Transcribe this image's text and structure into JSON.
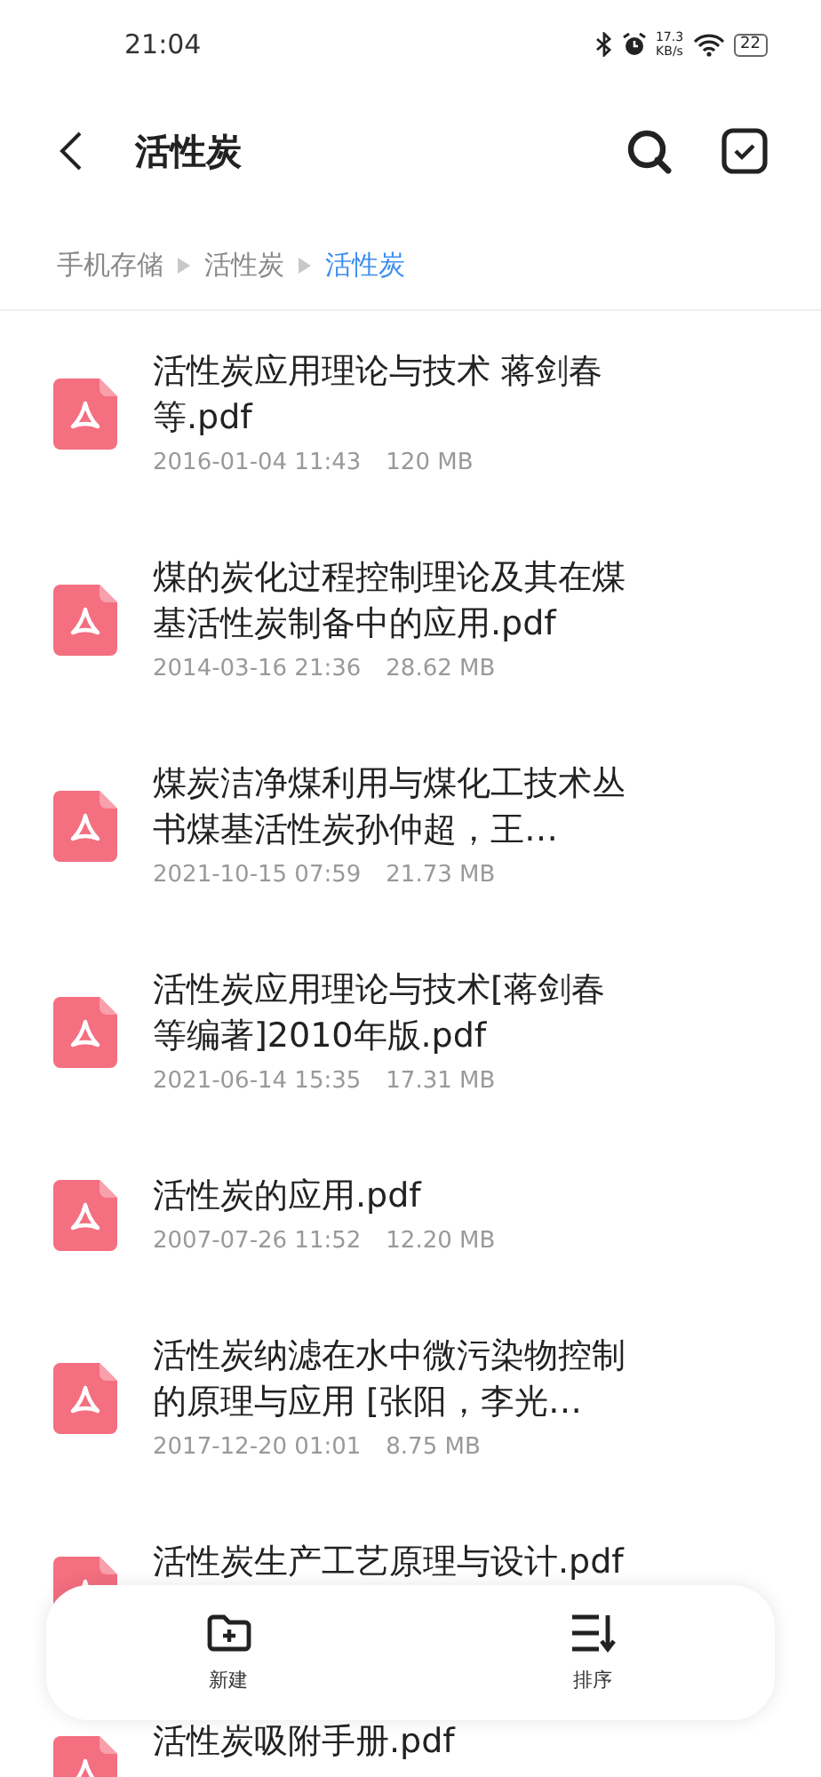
{
  "status_bar": {
    "time": "21:04",
    "speed_value": "17.3",
    "speed_unit": "KB/s",
    "battery": "22"
  },
  "header": {
    "title": "活性炭"
  },
  "breadcrumb": [
    {
      "label": "手机存储",
      "selected": false
    },
    {
      "label": "活性炭",
      "selected": false
    },
    {
      "label": "活性炭",
      "selected": true
    }
  ],
  "files": [
    {
      "kind": "pdf",
      "name": "活性炭应用理论与技术 蒋剑春等.pdf",
      "date": "2016-01-04 11:43",
      "size": "120 MB"
    },
    {
      "kind": "pdf",
      "name": "煤的炭化过程控制理论及其在煤基活性炭制备中的应用.pdf",
      "date": "2014-03-16 21:36",
      "size": "28.62 MB"
    },
    {
      "kind": "pdf",
      "name": "煤炭洁净煤利用与煤化工技术丛书煤基活性炭孙仲超，王…",
      "date": "2021-10-15 07:59",
      "size": "21.73 MB"
    },
    {
      "kind": "pdf",
      "name": "活性炭应用理论与技术[蒋剑春等编著]2010年版.pdf",
      "date": "2021-06-14 15:35",
      "size": "17.31 MB"
    },
    {
      "kind": "pdf",
      "name": "活性炭的应用.pdf",
      "date": "2007-07-26 11:52",
      "size": "12.20 MB"
    },
    {
      "kind": "pdf",
      "name": "活性炭纳滤在水中微污染物控制的原理与应用 [张阳，李光…",
      "date": "2017-12-20 01:01",
      "size": "8.75 MB"
    },
    {
      "kind": "pdf",
      "name": "活性炭生产工艺原理与设计.pdf"
    },
    {
      "kind": "pdf",
      "name": "活性炭吸附手册.pdf"
    }
  ],
  "toolbar": [
    {
      "kind": "new-folder",
      "label": "新建"
    },
    {
      "kind": "sort",
      "label": "排序"
    }
  ]
}
